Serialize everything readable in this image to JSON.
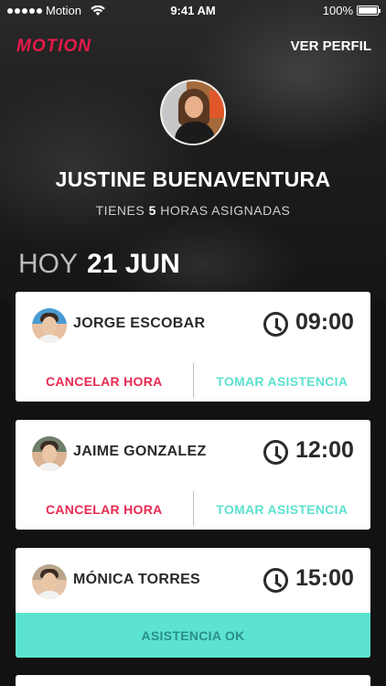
{
  "status_bar": {
    "carrier": "Motion",
    "time": "9:41 AM",
    "battery": "100%",
    "battery_level": 1.0
  },
  "header": {
    "logo": "MOTION",
    "profile_link": "VER PERFIL"
  },
  "profile": {
    "name": "JUSTINE BUENAVENTURA",
    "hours_prefix": "TIENES",
    "hours_count": "5",
    "hours_suffix": "HORAS ASIGNADAS"
  },
  "date": {
    "label": "HOY",
    "value": "21 JUN"
  },
  "appointments": [
    {
      "name": "JORGE ESCOBAR",
      "time": "09:00",
      "cancel_label": "CANCELAR HORA",
      "attend_label": "TOMAR ASISTENCIA"
    },
    {
      "name": "JAIME GONZALEZ",
      "time": "12:00",
      "cancel_label": "CANCELAR HORA",
      "attend_label": "TOMAR ASISTENCIA"
    },
    {
      "name": "MÓNICA TORRES",
      "time": "15:00",
      "status_label": "ASISTENCIA OK"
    }
  ],
  "colors": {
    "brand": "#e8194a",
    "cancel": "#e8294f",
    "attend": "#5ee0cf",
    "ok_bg": "#5be3cf"
  },
  "icons": {
    "clock": "clock-icon",
    "wifi": "wifi-icon",
    "battery": "battery-icon"
  }
}
